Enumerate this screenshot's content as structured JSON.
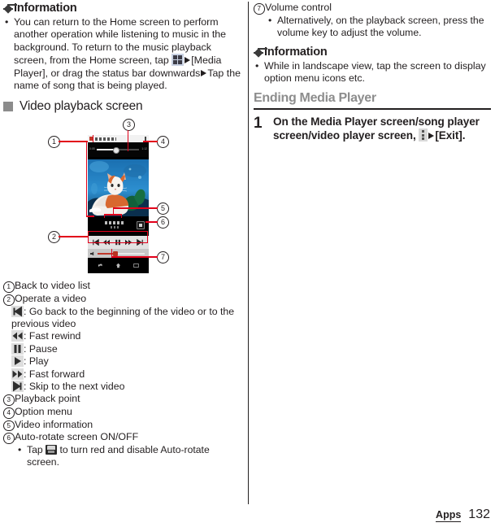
{
  "document": {
    "footer": {
      "section": "Apps",
      "page": "132"
    }
  },
  "left_column": {
    "information_heading": "Information",
    "information_bullets": [
      "You can return to the Home screen to perform another operation while listening to music in the background. To return to the music playback screen, from the Home screen, tap "
    ],
    "information_bullet_parts": {
      "part1": "You can return to the Home screen to perform another operation while listening to music in the background. To return to the music playback screen, from the Home screen, tap ",
      "app_drawer_icon": "app-drawer-icon",
      "part2": "[Media Player], or drag the status bar downwards",
      "part3": "Tap the name of song that is being played."
    },
    "section": {
      "title": "Video playback screen",
      "bullet_marker": "square"
    },
    "figure": {
      "callouts": [
        "1",
        "2",
        "3",
        "4",
        "5",
        "6",
        "7"
      ],
      "phone_screen": {
        "seek_time_left": "0:05",
        "seek_time_right": "1:12"
      }
    },
    "legend": [
      {
        "num": "1",
        "text": "Back to video list"
      },
      {
        "num": "2",
        "text": "Operate a video"
      },
      {
        "num": "3",
        "text": "Playback point"
      },
      {
        "num": "4",
        "text": "Option menu"
      },
      {
        "num": "5",
        "text": "Video information"
      },
      {
        "num": "6",
        "text": "Auto-rotate screen ON/OFF"
      }
    ],
    "operate_video_items": [
      {
        "icon": "skip-previous-icon",
        "text": ": Go back to the beginning of the video or to the previous video"
      },
      {
        "icon": "fast-rewind-icon",
        "text": ": Fast rewind"
      },
      {
        "icon": "pause-icon",
        "text": ": Pause"
      },
      {
        "icon": "play-icon",
        "text": ": Play"
      },
      {
        "icon": "fast-forward-icon",
        "text": ": Fast forward"
      },
      {
        "icon": "skip-next-icon",
        "text": ": Skip to the next video"
      }
    ],
    "autorotate_note": {
      "prefix": "Tap",
      "icon": "auto-rotate-icon",
      "suffix": "to turn red and disable Auto-rotate screen."
    }
  },
  "right_column": {
    "legend_seven": {
      "num": "7",
      "text": "Volume control"
    },
    "legend_seven_sub": "Alternatively, on the playback screen, press the volume key to adjust the volume.",
    "information_heading": "Information",
    "information_bullet": "While in landscape view, tap the screen to display option menu icons etc.",
    "chapter_heading": "Ending Media Player",
    "step": {
      "number": "1",
      "text_line1": "On the Media Player screen/song",
      "text_line2": "player screen/video player screen,",
      "menu_icon": "kebab-menu-icon",
      "text_line3": "[Exit]."
    }
  },
  "colors": {
    "accent_red": "#e2001a",
    "text": "#231f20",
    "heading_gray": "#8d8d8d",
    "square_gray": "#8c8c8c"
  }
}
